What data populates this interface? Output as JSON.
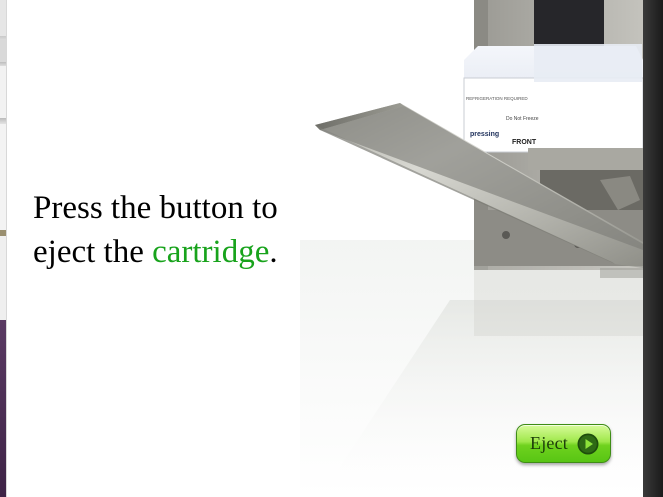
{
  "instruction": {
    "line1": "Press the button to",
    "line2_prefix": "eject the ",
    "line2_highlight": "cartridge",
    "line2_suffix": "."
  },
  "eject_button": {
    "label": "Eject",
    "icon": "play-circle-icon"
  },
  "cartridge_label": {
    "brand": "pressing",
    "front_text": "FRONT",
    "fine_print_1": "REFRIGERATION REQUIRED",
    "fine_print_2": "Do Not Freeze"
  },
  "colors": {
    "highlight_green": "#18a31c",
    "button_green": "#6fd21e",
    "icon_dark_green": "#1e4d0c"
  }
}
